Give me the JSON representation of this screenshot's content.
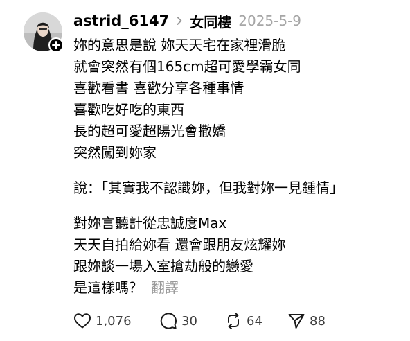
{
  "post": {
    "username": "astrid_6147",
    "community": "女同樓",
    "date": "2025-5-9",
    "lines": [
      "妳的意思是說 妳天天宅在家裡滑脆",
      "就會突然有個165cm超可愛學霸女同",
      "喜歡看書 喜歡分享各種事情",
      "喜歡吃好吃的東西",
      "長的超可愛超陽光會撒嬌",
      "突然闖到妳家",
      "說：「其實我不認識妳，但我對妳一見鍾情」",
      "對妳言聽計從忠誠度Max",
      "天天自拍給妳看 還會跟朋友炫耀妳",
      "跟妳談一場入室搶劫般的戀愛",
      "是這樣嗎？"
    ],
    "translate_label": "翻譯"
  },
  "actions": {
    "likes": "1,076",
    "comments": "30",
    "reposts": "64",
    "shares": "88"
  },
  "icons": {
    "avatar": "profile-photo",
    "follow": "plus-icon",
    "chevron": "chevron-right-icon",
    "like": "heart-icon",
    "comment": "speech-bubble-icon",
    "repost": "repost-icon",
    "share": "paper-plane-icon"
  },
  "colors": {
    "text": "#000000",
    "muted": "#a6a6a6",
    "count": "#3d3d3d"
  }
}
